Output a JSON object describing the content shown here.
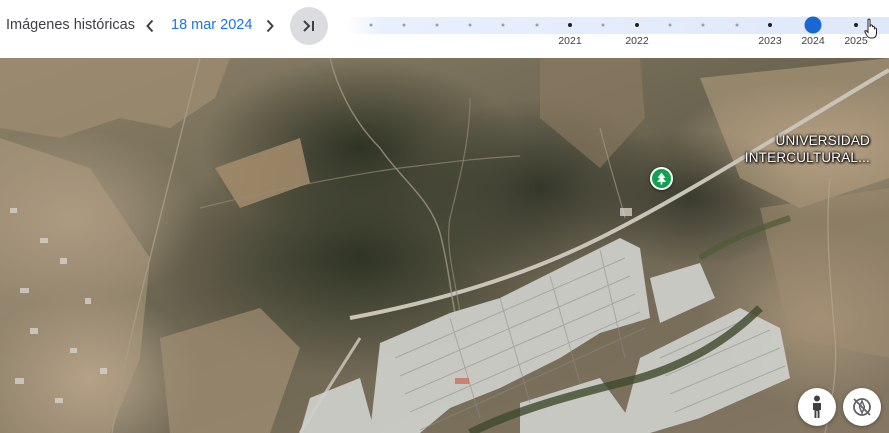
{
  "history_bar": {
    "title": "Imágenes históricas",
    "selected_date": "18 mar 2024",
    "prev_icon": "chevron-left-icon",
    "next_icon": "chevron-right-icon",
    "latest_icon": "skip-to-latest-icon",
    "timeline_years": [
      "2021",
      "2022",
      "2023",
      "2024",
      "2025"
    ],
    "selected_year": "2024",
    "accent_color": "#1a73e8",
    "selected_dot_color": "#1967d2"
  },
  "map": {
    "poi_label_line1": "UNIVERSIDAD",
    "poi_label_line2": "INTERCULTURAL...",
    "poi_icon": "park-tree-icon",
    "poi_color": "#12a151",
    "controls": {
      "pegman_icon": "pegman-icon",
      "compass_icon": "compass-disabled-icon"
    }
  }
}
